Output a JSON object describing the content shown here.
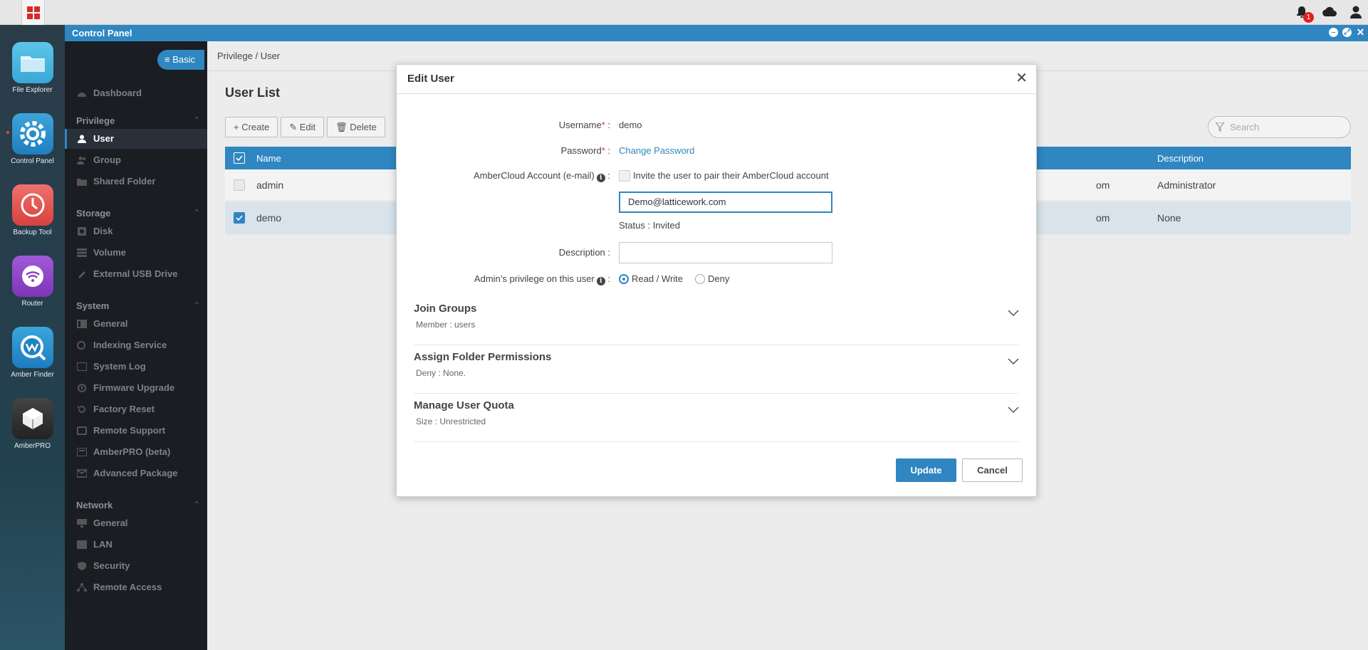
{
  "window": {
    "title": "Control Panel"
  },
  "topbar": {
    "notification_count": "1"
  },
  "dock": [
    {
      "label": "File Explorer",
      "icon": "folder-icon"
    },
    {
      "label": "Control Panel",
      "icon": "gear-icon"
    },
    {
      "label": "Backup Tool",
      "icon": "clock-icon"
    },
    {
      "label": "Router",
      "icon": "wifi-icon"
    },
    {
      "label": "Amber Finder",
      "icon": "finder-icon"
    },
    {
      "label": "AmberPRO",
      "icon": "cube-icon"
    }
  ],
  "sidebar": {
    "mode_label": "Basic",
    "dashboard": "Dashboard",
    "sections": {
      "privilege": "Privilege",
      "storage": "Storage",
      "system": "System",
      "network": "Network"
    },
    "privilege_items": [
      "User",
      "Group",
      "Shared Folder"
    ],
    "storage_items": [
      "Disk",
      "Volume",
      "External USB Drive"
    ],
    "system_items": [
      "General",
      "Indexing Service",
      "System Log",
      "Firmware Upgrade",
      "Factory Reset",
      "Remote Support",
      "AmberPRO (beta)",
      "Advanced Package"
    ],
    "network_items": [
      "General",
      "LAN",
      "Security",
      "Remote Access"
    ]
  },
  "main": {
    "breadcrumb": "Privilege / User",
    "title": "User List",
    "toolbar": {
      "create": "Create",
      "edit": "Edit",
      "delete": "Delete"
    },
    "search_placeholder": "Search",
    "table": {
      "headers": {
        "name": "Name",
        "description": "Description"
      },
      "rows": [
        {
          "name": "admin",
          "email_fragment": "om",
          "description": "Administrator",
          "checked": false
        },
        {
          "name": "demo",
          "email_fragment": "om",
          "description": "None",
          "checked": true
        }
      ]
    }
  },
  "dialog": {
    "title": "Edit User",
    "username_label": "Username",
    "username_value": "demo",
    "password_label": "Password",
    "password_link": "Change Password",
    "ambercloud_label": "AmberCloud Account (e-mail)",
    "invite_label": "Invite the user to pair their AmberCloud account",
    "email_value": "Demo@latticework.com",
    "status_text": "Status : Invited",
    "description_label": "Description :",
    "description_value": "",
    "privilege_label": "Admin’s privilege on this user",
    "privilege_options": [
      "Read / Write",
      "Deny"
    ],
    "privilege_selected": "Read / Write",
    "sections": [
      {
        "title": "Join Groups",
        "subtitle": "Member : users"
      },
      {
        "title": "Assign Folder Permissions",
        "subtitle": "Deny : None."
      },
      {
        "title": "Manage User Quota",
        "subtitle": "Size :  Unrestricted"
      }
    ],
    "update_button": "Update",
    "cancel_button": "Cancel"
  },
  "colors": {
    "accent": "#2f86c1",
    "sidebar_bg": "#1a1d22",
    "required": "#e0392e",
    "badge": "#e02020"
  }
}
